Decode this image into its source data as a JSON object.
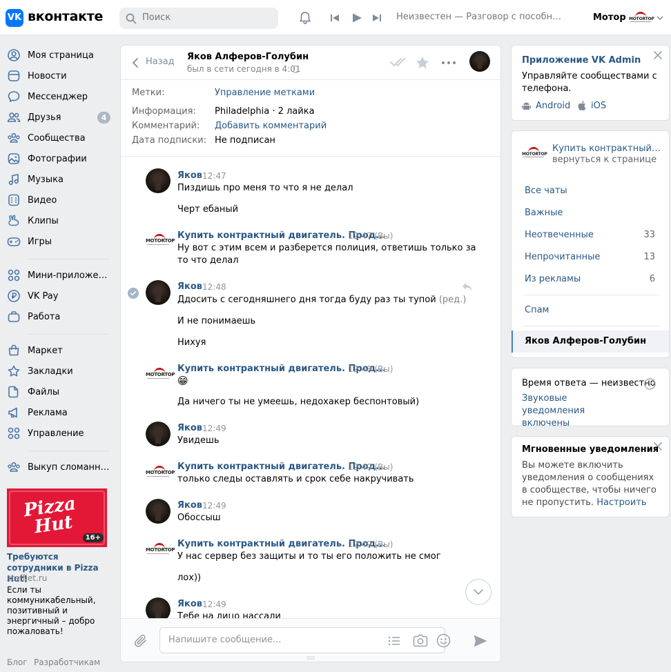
{
  "header": {
    "logo_badge": "VK",
    "logo_text": "вконтакте",
    "search_placeholder": "Поиск",
    "player_title": "Неизвестен — Разговор с пособни...",
    "profile_name": "Мотор",
    "profile_logo_text": "MOTORTOP"
  },
  "sidebar": {
    "items": [
      {
        "label": "Моя страница",
        "icon": "user-icon"
      },
      {
        "label": "Новости",
        "icon": "news-icon"
      },
      {
        "label": "Мессенджер",
        "icon": "messenger-icon"
      },
      {
        "label": "Друзья",
        "icon": "friends-icon",
        "badge": "4"
      },
      {
        "label": "Сообщества",
        "icon": "communities-icon"
      },
      {
        "label": "Фотографии",
        "icon": "photos-icon"
      },
      {
        "label": "Музыка",
        "icon": "music-icon"
      },
      {
        "label": "Видео",
        "icon": "video-icon"
      },
      {
        "label": "Клипы",
        "icon": "clips-icon"
      },
      {
        "label": "Игры",
        "icon": "games-icon"
      },
      {
        "label": "Мини-приложения",
        "icon": "mini-apps-icon"
      },
      {
        "label": "VK Pay",
        "icon": "vkpay-icon"
      },
      {
        "label": "Работа",
        "icon": "work-icon"
      },
      {
        "label": "Маркет",
        "icon": "market-icon"
      },
      {
        "label": "Закладки",
        "icon": "bookmarks-icon"
      },
      {
        "label": "Файлы",
        "icon": "files-icon"
      },
      {
        "label": "Реклама",
        "icon": "ads-icon"
      },
      {
        "label": "Управление",
        "icon": "manage-icon"
      },
      {
        "label": "Выкуп сломанных...",
        "icon": "group-icon"
      }
    ],
    "ad": {
      "logo_line1": "Pizza",
      "logo_line2": "Hut",
      "age": "16+",
      "title": "Требуются сотрудники в Pizza Hut!",
      "domain": "staffjet.ru",
      "text": "Если ты коммуникабельный, позитивный и энергичный – добро пожаловать!"
    },
    "footer": {
      "blog": "Блог",
      "developers": "Разработчикам"
    }
  },
  "chat": {
    "back_label": "Назад",
    "peer_name": "Яков Алферов-Голубин",
    "peer_status": "был в сети сегодня в 4:01",
    "info": {
      "labels_key": "Метки:",
      "labels_value": "Управление метками",
      "info_key": "Информация:",
      "info_value": "Philadelphia · 2 лайка",
      "comment_key": "Комментарий:",
      "comment_value": "Добавить комментарий",
      "subscribe_key": "Дата подписки:",
      "subscribe_value": "Не подписан"
    },
    "messages": [
      {
        "author": "Яков",
        "time": "12:47",
        "lines": [
          "Пиздишь про меня то что я не делал",
          "Черт ебаный"
        ]
      },
      {
        "author": "Купить контрактный двигатель. Прод...",
        "time": "12:47 (Вы)",
        "lines": [
          "Ну вот с этим всем и разберется полиция, ответишь только за",
          "то что делал"
        ]
      },
      {
        "author": "Яков",
        "time": "12:48",
        "lines": [
          "Ддосить с сегодняшнего дня тогда буду раз ты тупой",
          "И не понимаешь",
          "Нихуя"
        ],
        "edited": "(ред.)"
      },
      {
        "author": "Купить контрактный двигатель. Прод...",
        "time": "12:48 (Вы)",
        "lines": [
          "😁",
          "Да ничего ты не умеешь, недохакер беспонтовый)"
        ]
      },
      {
        "author": "Яков",
        "time": "12:49",
        "lines": [
          "Увидешь"
        ]
      },
      {
        "author": "Купить контрактный двигатель. Прод...",
        "time": "12:49 (Вы)",
        "lines": [
          "только следы оставлять и срок себе накручивать"
        ]
      },
      {
        "author": "Яков",
        "time": "12:49",
        "lines": [
          "Обоссыш"
        ]
      },
      {
        "author": "Купить контрактный двигатель. Прод...",
        "time": "12:49 (Вы)",
        "lines": [
          "У нас сервер без защиты и то ты его положить не смог",
          "лох))"
        ]
      },
      {
        "author": "Яков",
        "time": "12:49",
        "lines": [
          "Тебе на лицо нассали"
        ]
      }
    ],
    "composer_placeholder": "Напишите сообщение..."
  },
  "right": {
    "vk_admin": {
      "title": "Приложение VK Admin",
      "text": "Управляйте сообществами с телефона.",
      "android": "Android",
      "ios": "iOS"
    },
    "community": {
      "name": "Купить контрактный дви...",
      "return": "вернуться к странице"
    },
    "filters": [
      {
        "label": "Все чаты",
        "count": ""
      },
      {
        "label": "Важные",
        "count": ""
      },
      {
        "label": "Неотвеченные",
        "count": "33"
      },
      {
        "label": "Непрочитанные",
        "count": "13"
      },
      {
        "label": "Из рекламы",
        "count": "6"
      },
      {
        "label": "Спам",
        "count": ""
      },
      {
        "label": "Яков Алферов-Голубин",
        "count": ""
      }
    ],
    "response": {
      "time_text": "Время ответа — неизвестно",
      "sound": "Звуковые уведомления включены"
    },
    "instant": {
      "title": "Мгновенные уведомления",
      "text1": "Вы можете включить",
      "text2": "уведомления о сообщениях",
      "text3": "в сообществе, чтобы ничего",
      "text4": "не пропустить.",
      "link": "Настроить"
    }
  }
}
